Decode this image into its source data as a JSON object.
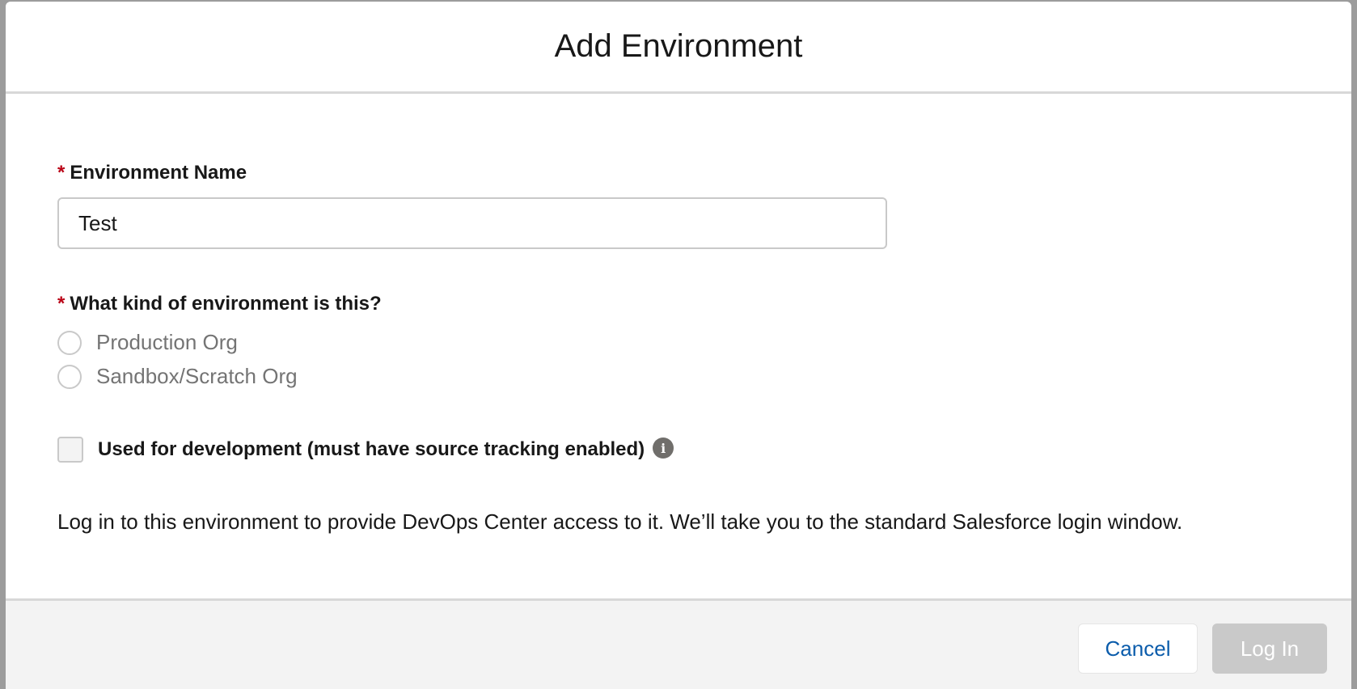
{
  "dialog": {
    "title": "Add Environment"
  },
  "form": {
    "required_marker": "*",
    "environment_name": {
      "label": "Environment Name",
      "value": "Test"
    },
    "environment_kind": {
      "label": "What kind of environment is this?",
      "options": [
        {
          "label": "Production Org",
          "selected": false
        },
        {
          "label": "Sandbox/Scratch Org",
          "selected": false
        }
      ]
    },
    "development_checkbox": {
      "label": "Used for development (must have source tracking enabled)",
      "checked": false,
      "info_icon": "info-icon"
    },
    "help_text": "Log in to this environment to provide DevOps Center access to it. We’ll take you to the standard Salesforce login window."
  },
  "footer": {
    "cancel_label": "Cancel",
    "login_label": "Log In"
  },
  "colors": {
    "required": "#ba0517",
    "link_blue": "#0b5cab",
    "disabled_button": "#c9c9c9"
  }
}
